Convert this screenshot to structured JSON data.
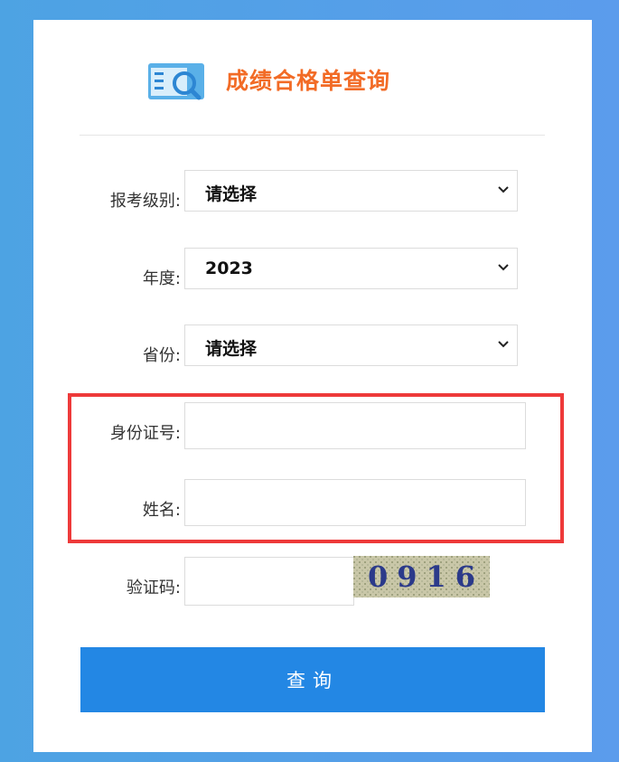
{
  "header": {
    "title": "成绩合格单查询",
    "logo_icon": "document-search-icon"
  },
  "form": {
    "level": {
      "label": "报考级别:",
      "value": "请选择"
    },
    "year": {
      "label": "年度:",
      "value": "2023"
    },
    "province": {
      "label": "省份:",
      "value": "请选择"
    },
    "id_number": {
      "label": "身份证号:",
      "value": ""
    },
    "name": {
      "label": "姓名:",
      "value": ""
    },
    "captcha": {
      "label": "验证码:",
      "value": "",
      "image_text": "0916"
    }
  },
  "submit_label": "查询",
  "colors": {
    "title": "#f26b26",
    "button": "#2387e4",
    "highlight": "#ee3a3a"
  }
}
